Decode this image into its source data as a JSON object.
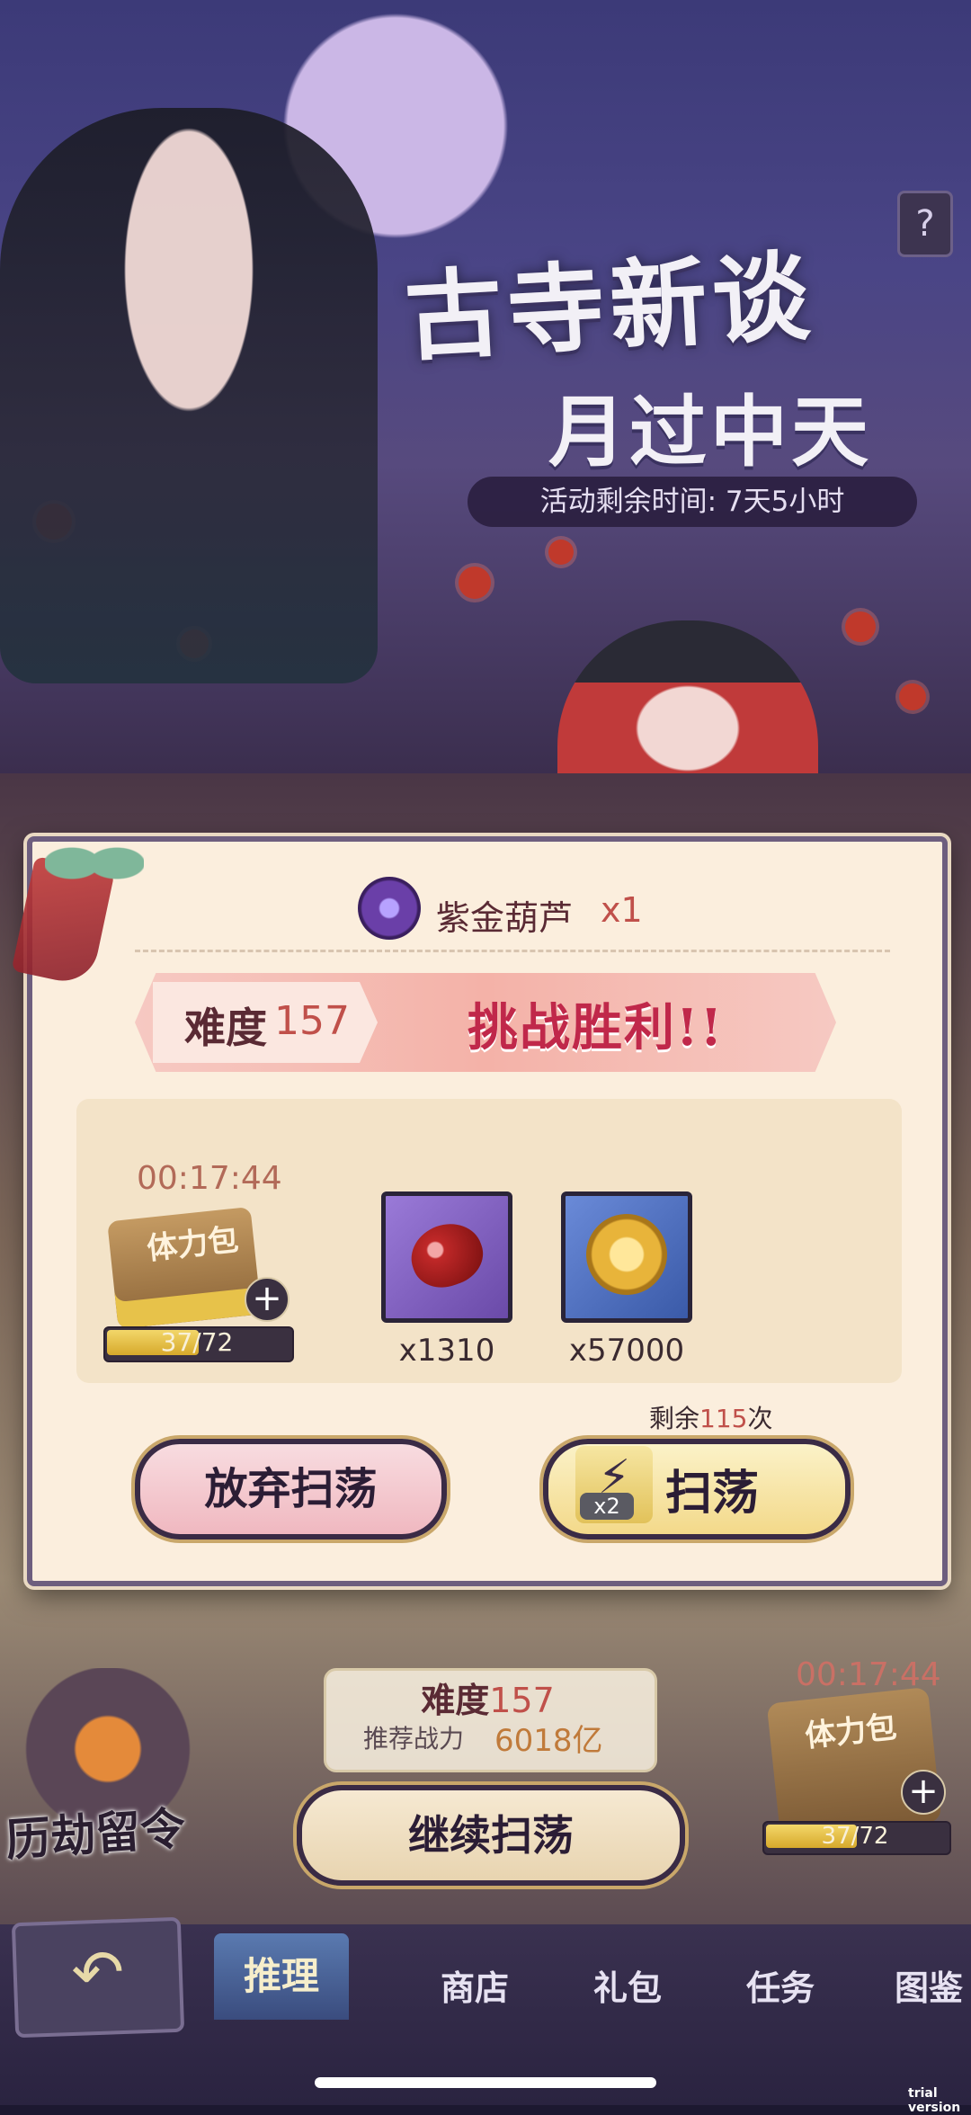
{
  "banner": {
    "title_line1": "古寺新谈",
    "title_line2": "月过中天",
    "event_timer": "活动剩余时间: 7天5小时",
    "help_label": "?"
  },
  "modal": {
    "reward_name": "紫金葫芦",
    "reward_qty": "x1",
    "result": {
      "difficulty_label": "难度",
      "difficulty_value": "157",
      "result_text": "挑战胜利!!"
    },
    "stamina": {
      "timer": "00:17:44",
      "pack_label": "体力包",
      "plus": "+",
      "bar_text": "37/72",
      "fill_fraction": 0.51
    },
    "items": [
      {
        "icon": "red-bean-icon",
        "count": "x1310"
      },
      {
        "icon": "gold-coin-icon",
        "count": "x57000"
      }
    ],
    "remaining": {
      "prefix": "剩余",
      "value": "115",
      "suffix": "次"
    },
    "abandon_label": "放弃扫荡",
    "sweep_label": "扫荡",
    "sweep_multiplier": "x2"
  },
  "background_panel": {
    "difficulty_label": "难度",
    "difficulty_value": "157",
    "power_label": "推荐战力",
    "power_value": "6018亿",
    "continue_label": "继续扫荡",
    "lantern_label": "历劫留令",
    "stamina_timer": "00:17:44",
    "stamina_label": "体力包",
    "stamina_bar": "37/72",
    "plus": "+",
    "fill_fraction": 0.51
  },
  "nav": {
    "tabs": [
      "推理",
      "商店",
      "礼包",
      "任务",
      "图鉴"
    ],
    "active_tab": "推理",
    "back_icon": "back-arrow-icon"
  },
  "watermark": "trial version",
  "colors": {
    "accent_red": "#c0504a",
    "modal_bg": "#fbeedd",
    "nav_bg": "#2a2340"
  }
}
